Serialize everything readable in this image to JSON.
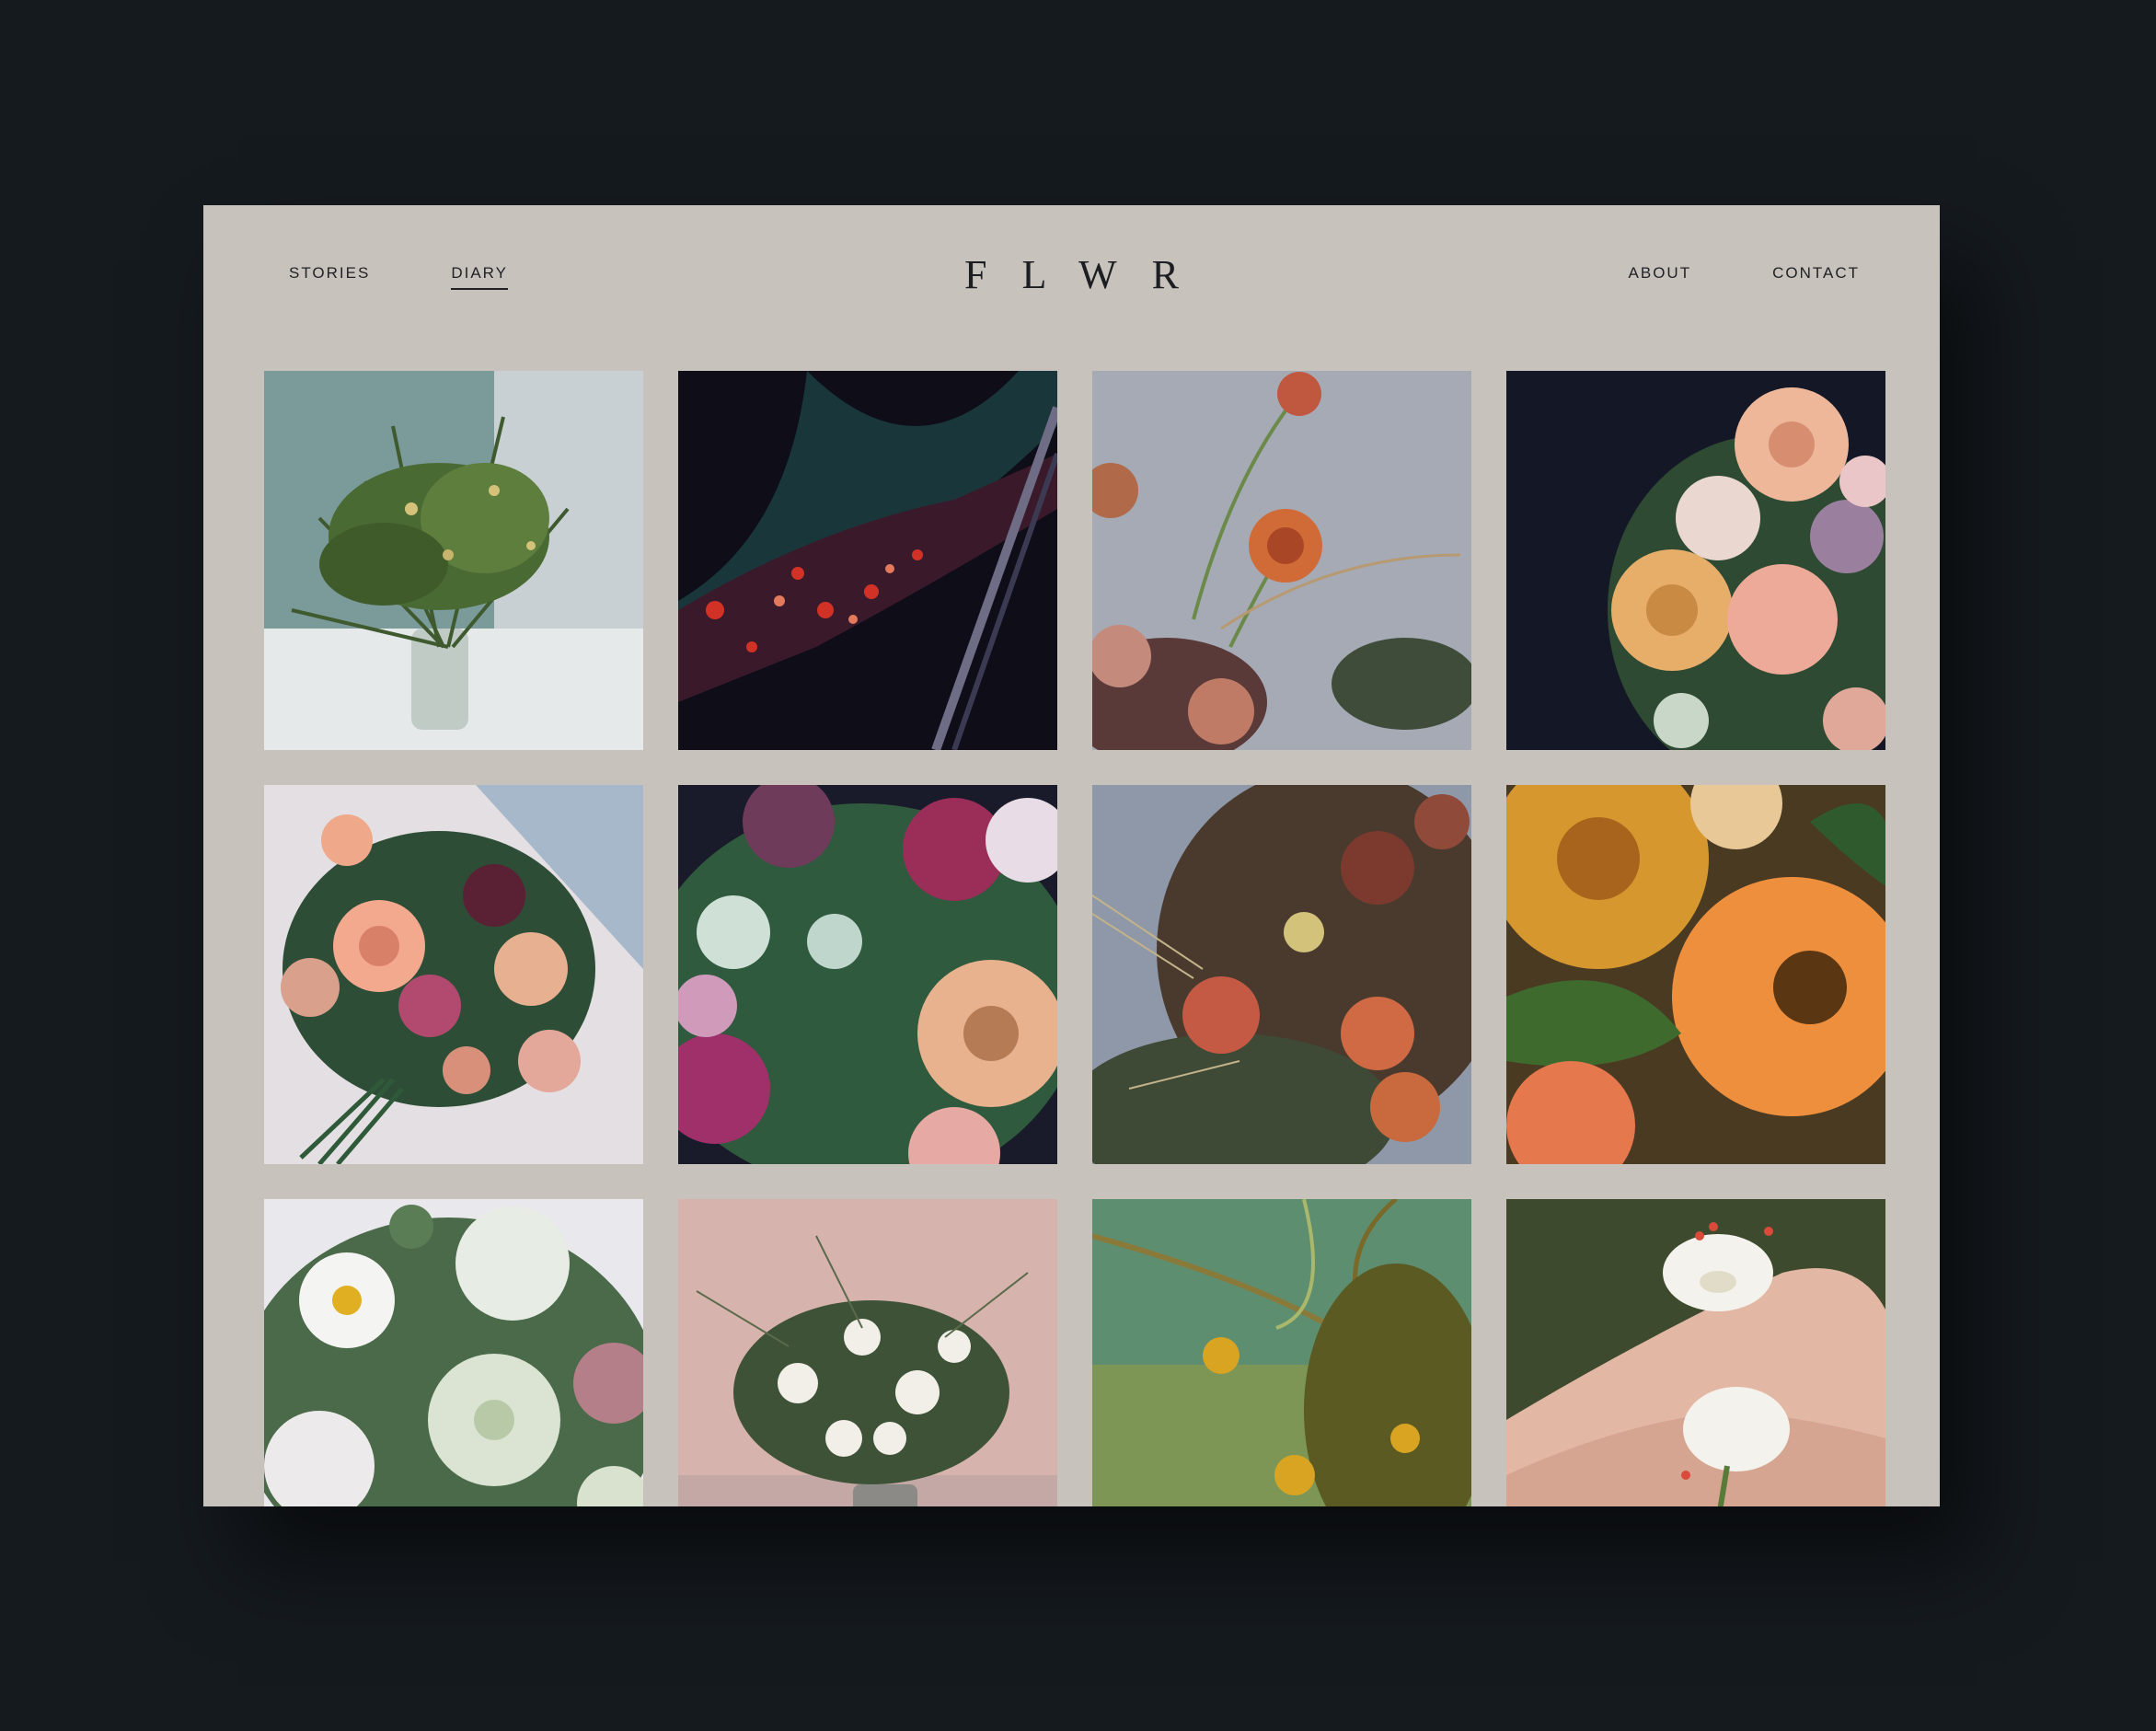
{
  "header": {
    "nav_left": [
      {
        "label": "STORIES",
        "active": false
      },
      {
        "label": "DIARY",
        "active": true
      }
    ],
    "logo": "FLWR",
    "nav_right": [
      {
        "label": "ABOUT"
      },
      {
        "label": "CONTACT"
      }
    ]
  },
  "gallery": {
    "tiles": [
      {
        "subject": "fern-bouquet-in-glass-vase"
      },
      {
        "subject": "petals-on-dark-street"
      },
      {
        "subject": "orange-ranunculus-stems"
      },
      {
        "subject": "peach-ranunculus-bouquet"
      },
      {
        "subject": "pink-rose-bouquet"
      },
      {
        "subject": "plum-rose-ranunculus-closeup"
      },
      {
        "subject": "autumn-rose-arrangement"
      },
      {
        "subject": "orange-ranunculus-closeup"
      },
      {
        "subject": "white-daisy-lisianthus"
      },
      {
        "subject": "white-bouquet-in-vase"
      },
      {
        "subject": "yellow-flowers-on-green"
      },
      {
        "subject": "calla-lilies-on-skin"
      }
    ]
  },
  "colors": {
    "backdrop": "#151a1f",
    "page": "#c8c2bd",
    "text": "#1f2124"
  }
}
